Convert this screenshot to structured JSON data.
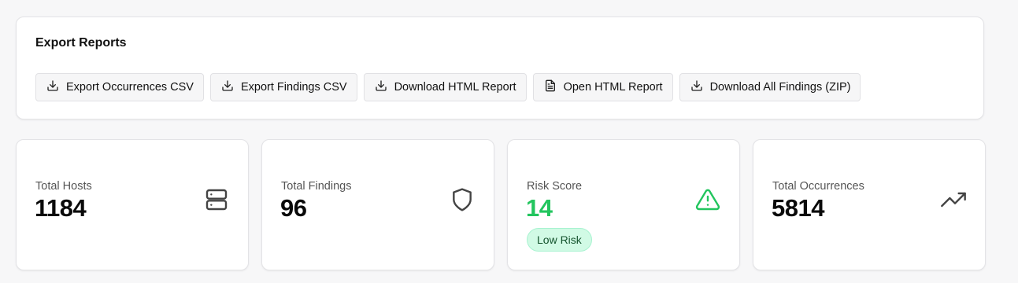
{
  "export": {
    "title": "Export Reports",
    "buttons": [
      {
        "label": "Export Occurrences CSV",
        "icon": "download-icon"
      },
      {
        "label": "Export Findings CSV",
        "icon": "download-icon"
      },
      {
        "label": "Download HTML Report",
        "icon": "download-icon"
      },
      {
        "label": "Open HTML Report",
        "icon": "file-text-icon"
      },
      {
        "label": "Download All Findings (ZIP)",
        "icon": "download-icon"
      }
    ]
  },
  "stats": [
    {
      "label": "Total Hosts",
      "value": "1184",
      "icon": "server-icon"
    },
    {
      "label": "Total Findings",
      "value": "96",
      "icon": "shield-icon"
    },
    {
      "label": "Risk Score",
      "value": "14",
      "icon": "alert-triangle-icon",
      "value_color": "#22c55e",
      "badge": "Low Risk"
    },
    {
      "label": "Total Occurrences",
      "value": "5814",
      "icon": "trending-up-icon"
    }
  ],
  "colors": {
    "accent_green": "#22c55e",
    "badge_bg": "#d1fae5",
    "badge_text": "#14532d"
  }
}
